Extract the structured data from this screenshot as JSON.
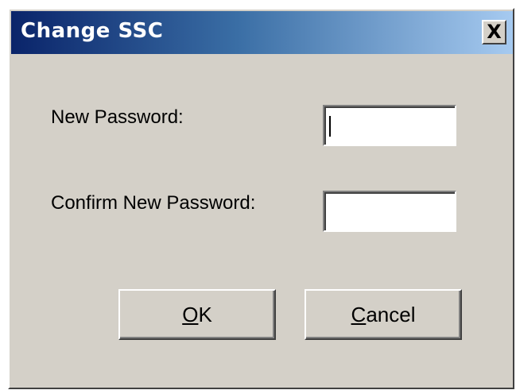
{
  "window": {
    "title": "Change SSC",
    "close_symbol": "X",
    "close_icon": "close-icon"
  },
  "form": {
    "new_password_label": "New Password:",
    "new_password_value": "",
    "confirm_password_label": "Confirm New Password:",
    "confirm_password_value": ""
  },
  "buttons": {
    "ok": {
      "mnemonic": "O",
      "rest": "K"
    },
    "cancel": {
      "mnemonic": "C",
      "rest": "ancel"
    }
  },
  "colors": {
    "titlebar_start": "#0a246a",
    "titlebar_end": "#a6caf0",
    "dialog_face": "#d4d0c8"
  }
}
